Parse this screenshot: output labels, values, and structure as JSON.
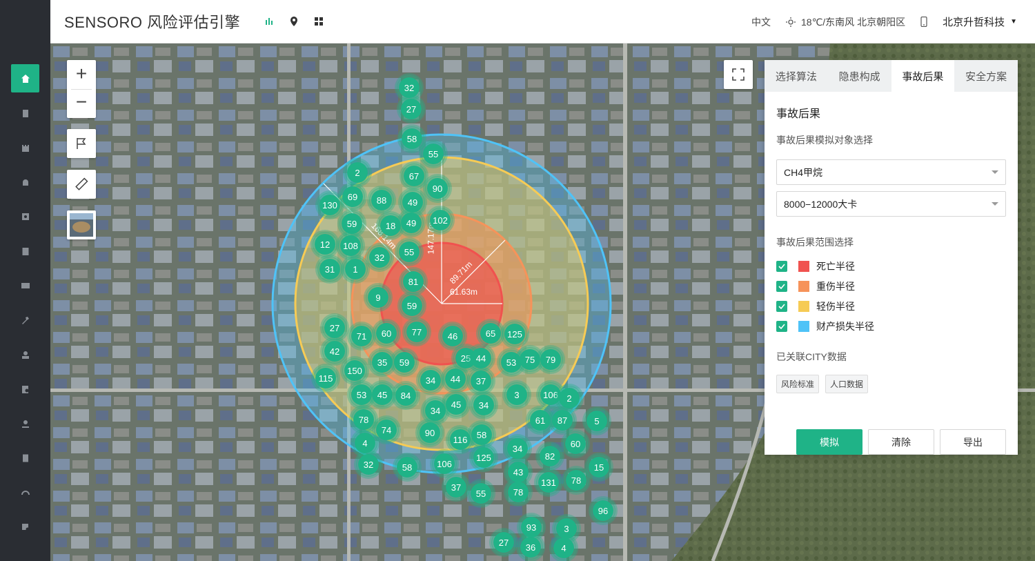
{
  "header": {
    "brand": "SENSORO 风险评估引擎",
    "icons": [
      "bar-chart-icon",
      "map-pin-icon",
      "grid-icon"
    ],
    "language": "中文",
    "weather": "18℃/东南风 北京朝阳区",
    "company": "北京升哲科技",
    "accent": "#1fb387"
  },
  "sidebar": {
    "items": [
      {
        "icon": "home-icon",
        "active": true
      },
      {
        "icon": "building-icon"
      },
      {
        "icon": "castle-icon"
      },
      {
        "icon": "alarm-icon"
      },
      {
        "icon": "target-icon"
      },
      {
        "icon": "clipboard-icon"
      },
      {
        "icon": "id-card-icon"
      },
      {
        "icon": "wrench-icon"
      },
      {
        "icon": "user-icon"
      },
      {
        "icon": "search-document-icon"
      },
      {
        "icon": "user-badge-icon"
      },
      {
        "icon": "report-icon"
      },
      {
        "icon": "gauge-icon"
      },
      {
        "icon": "inspect-icon"
      }
    ]
  },
  "map": {
    "radius_labels": {
      "outer": "168.14m",
      "yellow": "147.17m",
      "orange": "89.71m",
      "red": "61.63m"
    },
    "clusters": [
      "32",
      "27",
      "58",
      "55",
      "2",
      "67",
      "90",
      "130",
      "69",
      "88",
      "49",
      "59",
      "18",
      "49",
      "102",
      "12",
      "108",
      "32",
      "55",
      "31",
      "1",
      "81",
      "59",
      "9",
      "27",
      "71",
      "60",
      "77",
      "46",
      "65",
      "125",
      "42",
      "35",
      "59",
      "25",
      "44",
      "53",
      "75",
      "79",
      "115",
      "150",
      "44",
      "34",
      "37",
      "53",
      "45",
      "84",
      "3",
      "106",
      "2",
      "78",
      "34",
      "45",
      "34",
      "61",
      "87",
      "5",
      "74",
      "90",
      "116",
      "58",
      "34",
      "60",
      "4",
      "32",
      "58",
      "106",
      "125",
      "82",
      "15",
      "43",
      "131",
      "78",
      "37",
      "55",
      "78",
      "96",
      "93",
      "3",
      "27",
      "36",
      "4"
    ]
  },
  "panel": {
    "tabs": [
      "选择算法",
      "隐患构成",
      "事故后果",
      "安全方案"
    ],
    "active_tab": 2,
    "title": "事故后果",
    "object_label": "事故后果模拟对象选择",
    "select_gas": "CH4甲烷",
    "select_energy": "8000−12000大卡",
    "range_label": "事故后果范围选择",
    "ranges": [
      {
        "label": "死亡半径",
        "color": "#f0524f"
      },
      {
        "label": "重伤半径",
        "color": "#f6935a"
      },
      {
        "label": "轻伤半径",
        "color": "#f6cb55"
      },
      {
        "label": "财产损失半径",
        "color": "#4fc3f7"
      }
    ],
    "city_label": "已关联CITY数据",
    "tags": [
      "风险标准",
      "人口数据"
    ],
    "buttons": {
      "simulate": "模拟",
      "clear": "清除",
      "export": "导出"
    }
  }
}
